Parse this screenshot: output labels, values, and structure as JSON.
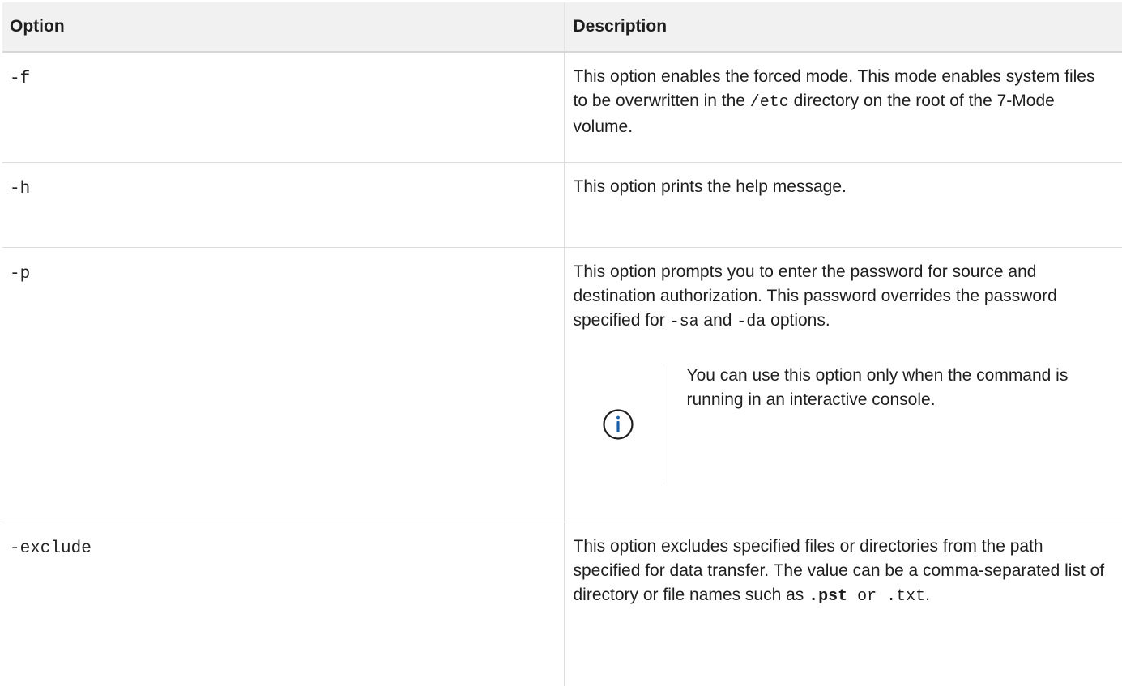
{
  "table": {
    "headers": [
      "Option",
      "Description"
    ],
    "rows": [
      {
        "option": "-f",
        "desc": [
          "This option enables the forced mode. This mode enables system files to be overwritten in the ",
          "/etc",
          " directory on the root of the 7-Mode volume."
        ]
      },
      {
        "option": "-h",
        "desc": [
          "This option prints the help message."
        ]
      },
      {
        "option": "-p",
        "desc": [
          "This option prompts you to enter the password for source and destination authorization. This password overrides the password specified for ",
          "-sa",
          " and ",
          "-da",
          " options."
        ],
        "note": {
          "icon": "info-icon",
          "text": "You can use this option only when the command is running in an interactive console."
        }
      },
      {
        "option": "-exclude",
        "desc": [
          "This option excludes specified files or directories from the path specified for data transfer. The value can be a comma-separated list of directory or file names such as ",
          ".pst",
          " or .txt",
          "."
        ]
      }
    ]
  },
  "colors": {
    "header_bg": "#f1f1f1",
    "border": "#dcdcdc",
    "info_icon": "#1a5fa8"
  }
}
